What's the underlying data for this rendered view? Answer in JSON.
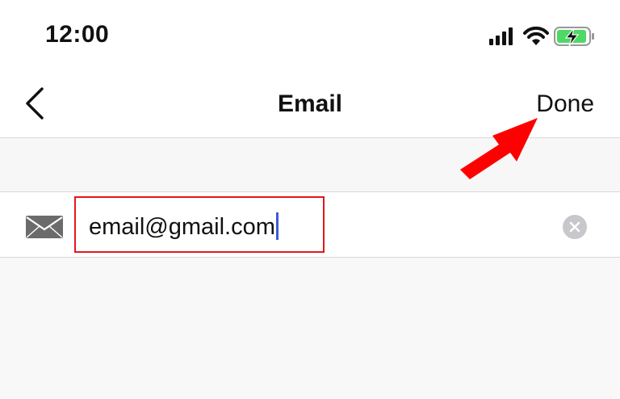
{
  "status_bar": {
    "time": "12:00",
    "icons": [
      "cellular-signal-icon",
      "wifi-icon",
      "battery-charging-icon"
    ],
    "battery_color": "#4cd964"
  },
  "nav": {
    "back_icon": "chevron-left-icon",
    "title": "Email",
    "done_label": "Done"
  },
  "email_field": {
    "icon": "envelope-icon",
    "value": "email@gmail.com",
    "clear_icon": "clear-circle-icon",
    "highlight_color": "#e4161b",
    "caret_color": "#3b5bd6"
  },
  "annotation": {
    "arrow_color": "#ff0000",
    "arrow_target": "Done"
  }
}
